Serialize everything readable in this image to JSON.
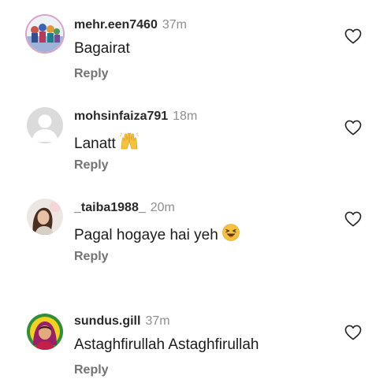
{
  "comments": [
    {
      "username": "mehr.een7460",
      "time": "37m",
      "text": "Bagairat",
      "reply_label": "Reply"
    },
    {
      "username": "mohsinfaiza791",
      "time": "18m",
      "text": "Lanatt",
      "reply_label": "Reply"
    },
    {
      "username": "_taiba1988_",
      "time": "20m",
      "text": "Pagal hogaye hai yeh",
      "reply_label": "Reply"
    },
    {
      "username": "sundus.gill",
      "time": "37m",
      "text": "Astaghfirullah Astaghfirullah",
      "reply_label": "Reply"
    }
  ],
  "icons": {
    "like": "heart-outline-icon",
    "emoji_1": "raising-hands-emoji",
    "emoji_2": "laughing-face-emoji"
  }
}
